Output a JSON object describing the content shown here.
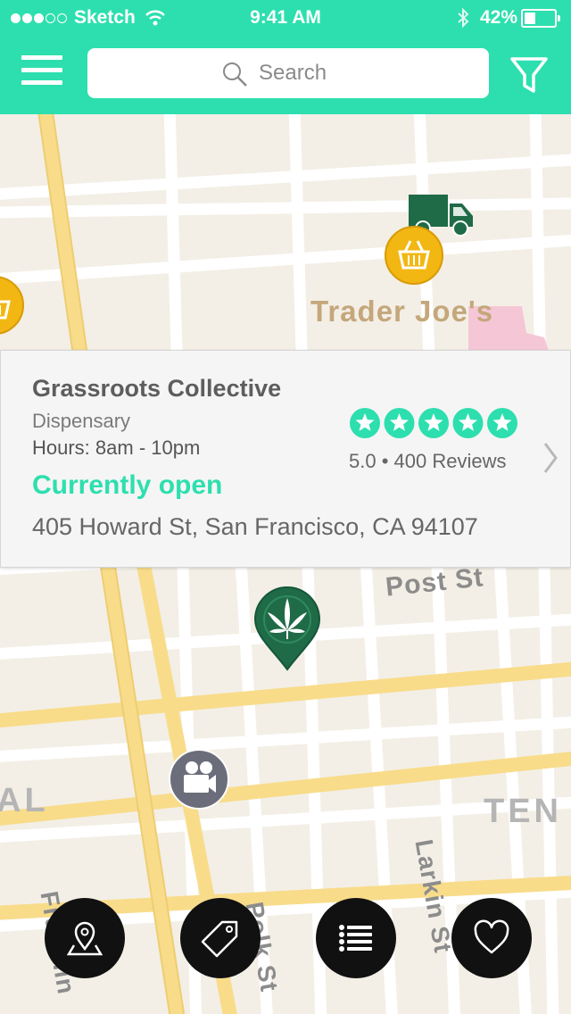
{
  "status_bar": {
    "carrier": "Sketch",
    "time": "9:41 AM",
    "battery": "42%",
    "battery_level": 0.42
  },
  "header": {
    "search_placeholder": "Search",
    "menu_icon": "hamburger-icon",
    "filter_icon": "filter-icon"
  },
  "map": {
    "labels": {
      "poi": "Trader Joe's",
      "street_post": "Post St",
      "street_polk": "Polk St",
      "street_larkin": "Larkin St",
      "street_franklin": "Franklin",
      "district_ten": "TEN",
      "district_al": "AL"
    },
    "markers": [
      "delivery-truck-icon",
      "grocery-basket-icon",
      "grocery-basket-icon",
      "dispensary-leaf-icon",
      "movie-camera-icon"
    ]
  },
  "card": {
    "name": "Grassroots Collective",
    "category": "Dispensary",
    "hours": "Hours: 8am - 10pm",
    "status": "Currently open",
    "address": "405 Howard St, San Francisco, CA 94107",
    "rating_value": 5.0,
    "rating_text": "5.0 • 400 Reviews",
    "stars": 5
  },
  "bottom_nav": [
    {
      "icon": "map-pin-icon"
    },
    {
      "icon": "tag-icon"
    },
    {
      "icon": "list-icon"
    },
    {
      "icon": "heart-icon"
    }
  ],
  "colors": {
    "accent": "#2ddfae",
    "marker_green": "#1f6b47",
    "marker_gold": "#f2b712",
    "road_yellow": "#f8dc8a"
  }
}
